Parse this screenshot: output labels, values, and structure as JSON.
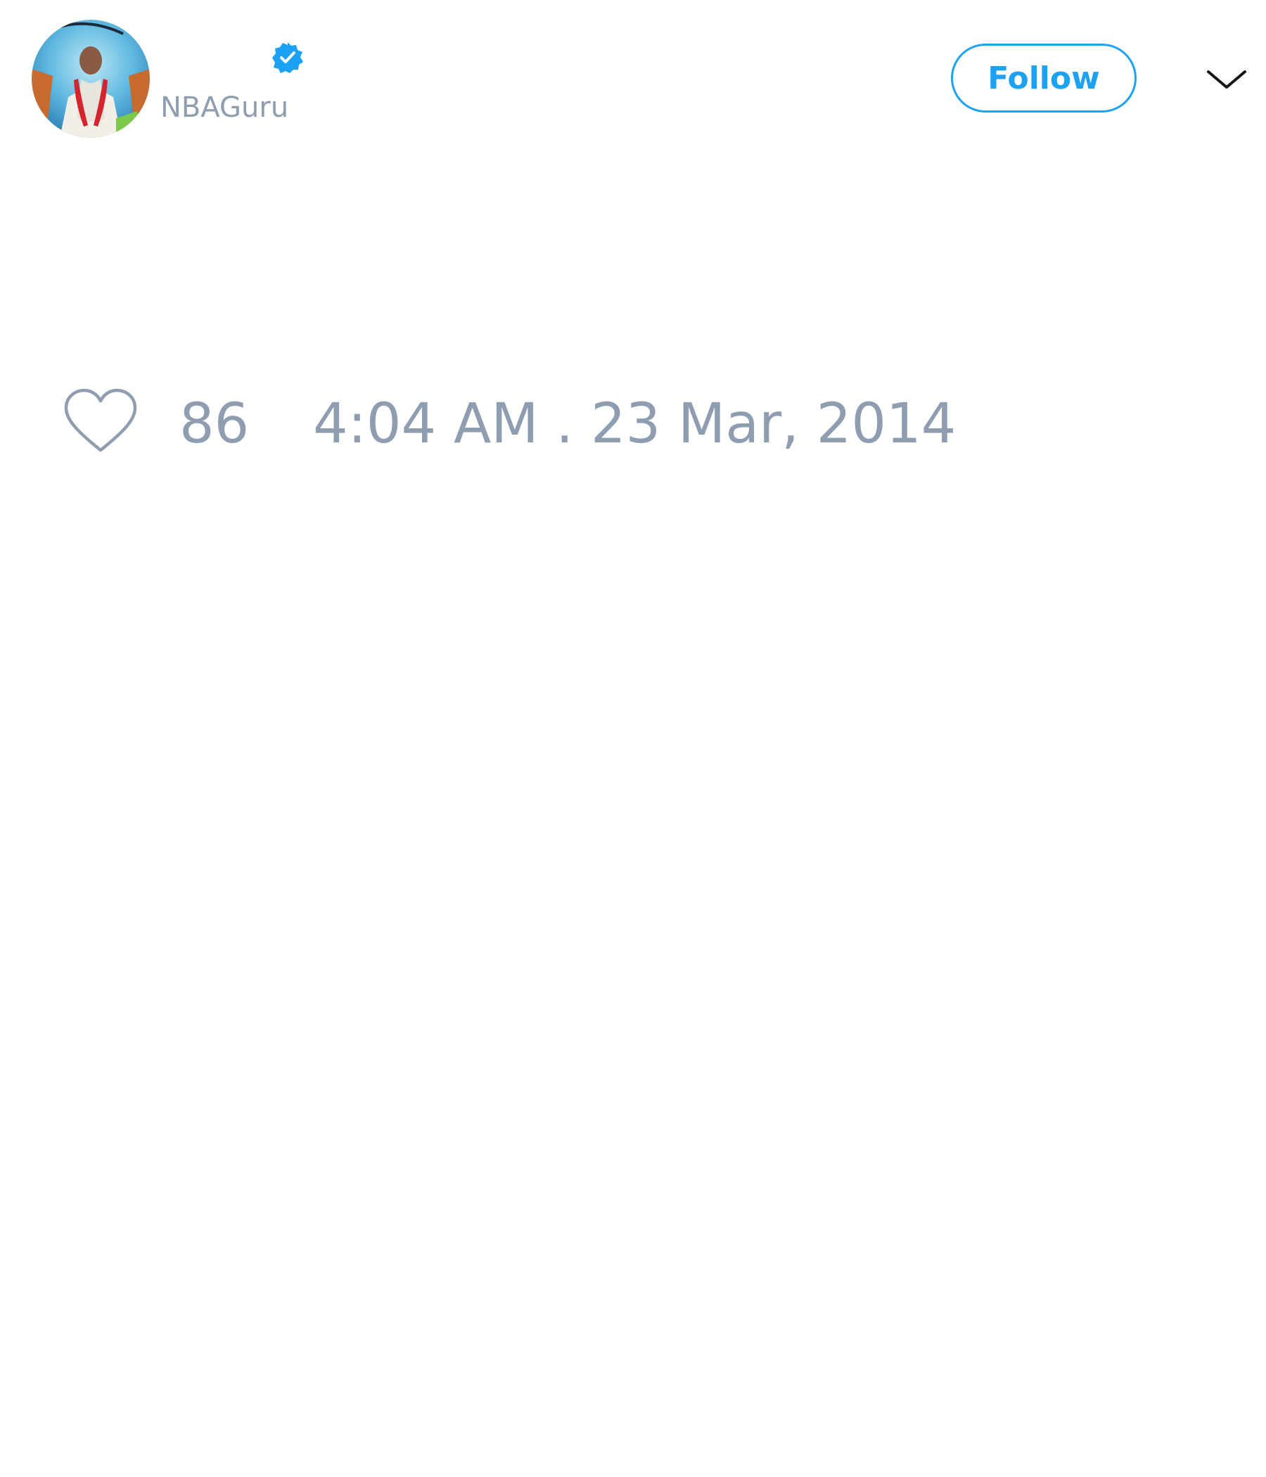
{
  "user": {
    "display_name": "",
    "handle": "NBAGuru",
    "verified": true,
    "avatar_icon": "avatar-photo"
  },
  "header": {
    "follow_label": "Follow",
    "menu_icon": "chevron-down-icon"
  },
  "footer": {
    "like_icon": "heart-outline-icon",
    "like_count": "86",
    "timestamp": "4:04 AM . 23 Mar, 2014"
  },
  "colors": {
    "accent": "#1da1f2",
    "muted_text": "#8f9db0",
    "background": "#ffffff"
  }
}
